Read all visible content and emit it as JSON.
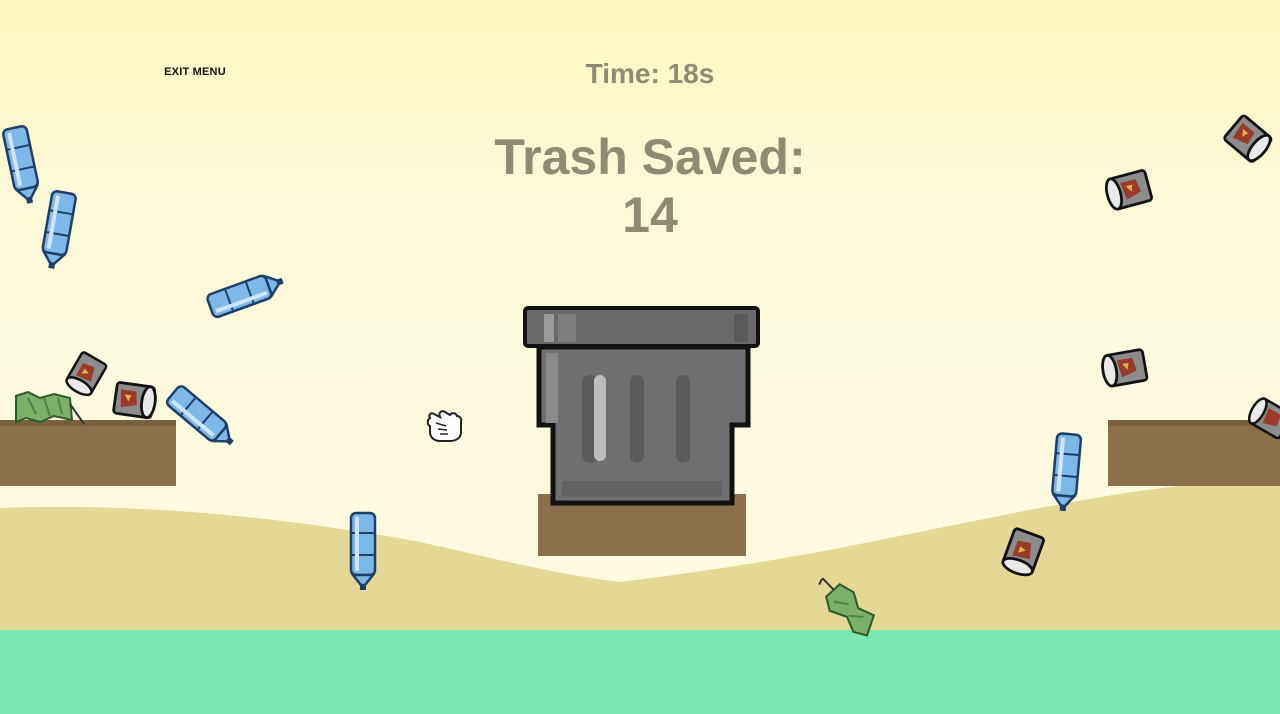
{
  "hud": {
    "exit_label": "EXIT MENU",
    "timer_text": "Time: 18s",
    "score_label": "Trash Saved:",
    "score_value": "14"
  },
  "colors": {
    "sky_top": "#fdf7bf",
    "sky_bottom": "#fdfae0",
    "sand": "#e3d896",
    "sea": "#7ee8b4",
    "dirt": "#8a6f4b",
    "hud_text": "#8e8b72",
    "bin": "#6f6f6f"
  },
  "scene": {
    "player_icon": "open-hand-cursor",
    "bin_icon": "trash-bin",
    "trash_kinds": [
      "plastic-bottle",
      "tin-can",
      "crushed-cup"
    ]
  }
}
